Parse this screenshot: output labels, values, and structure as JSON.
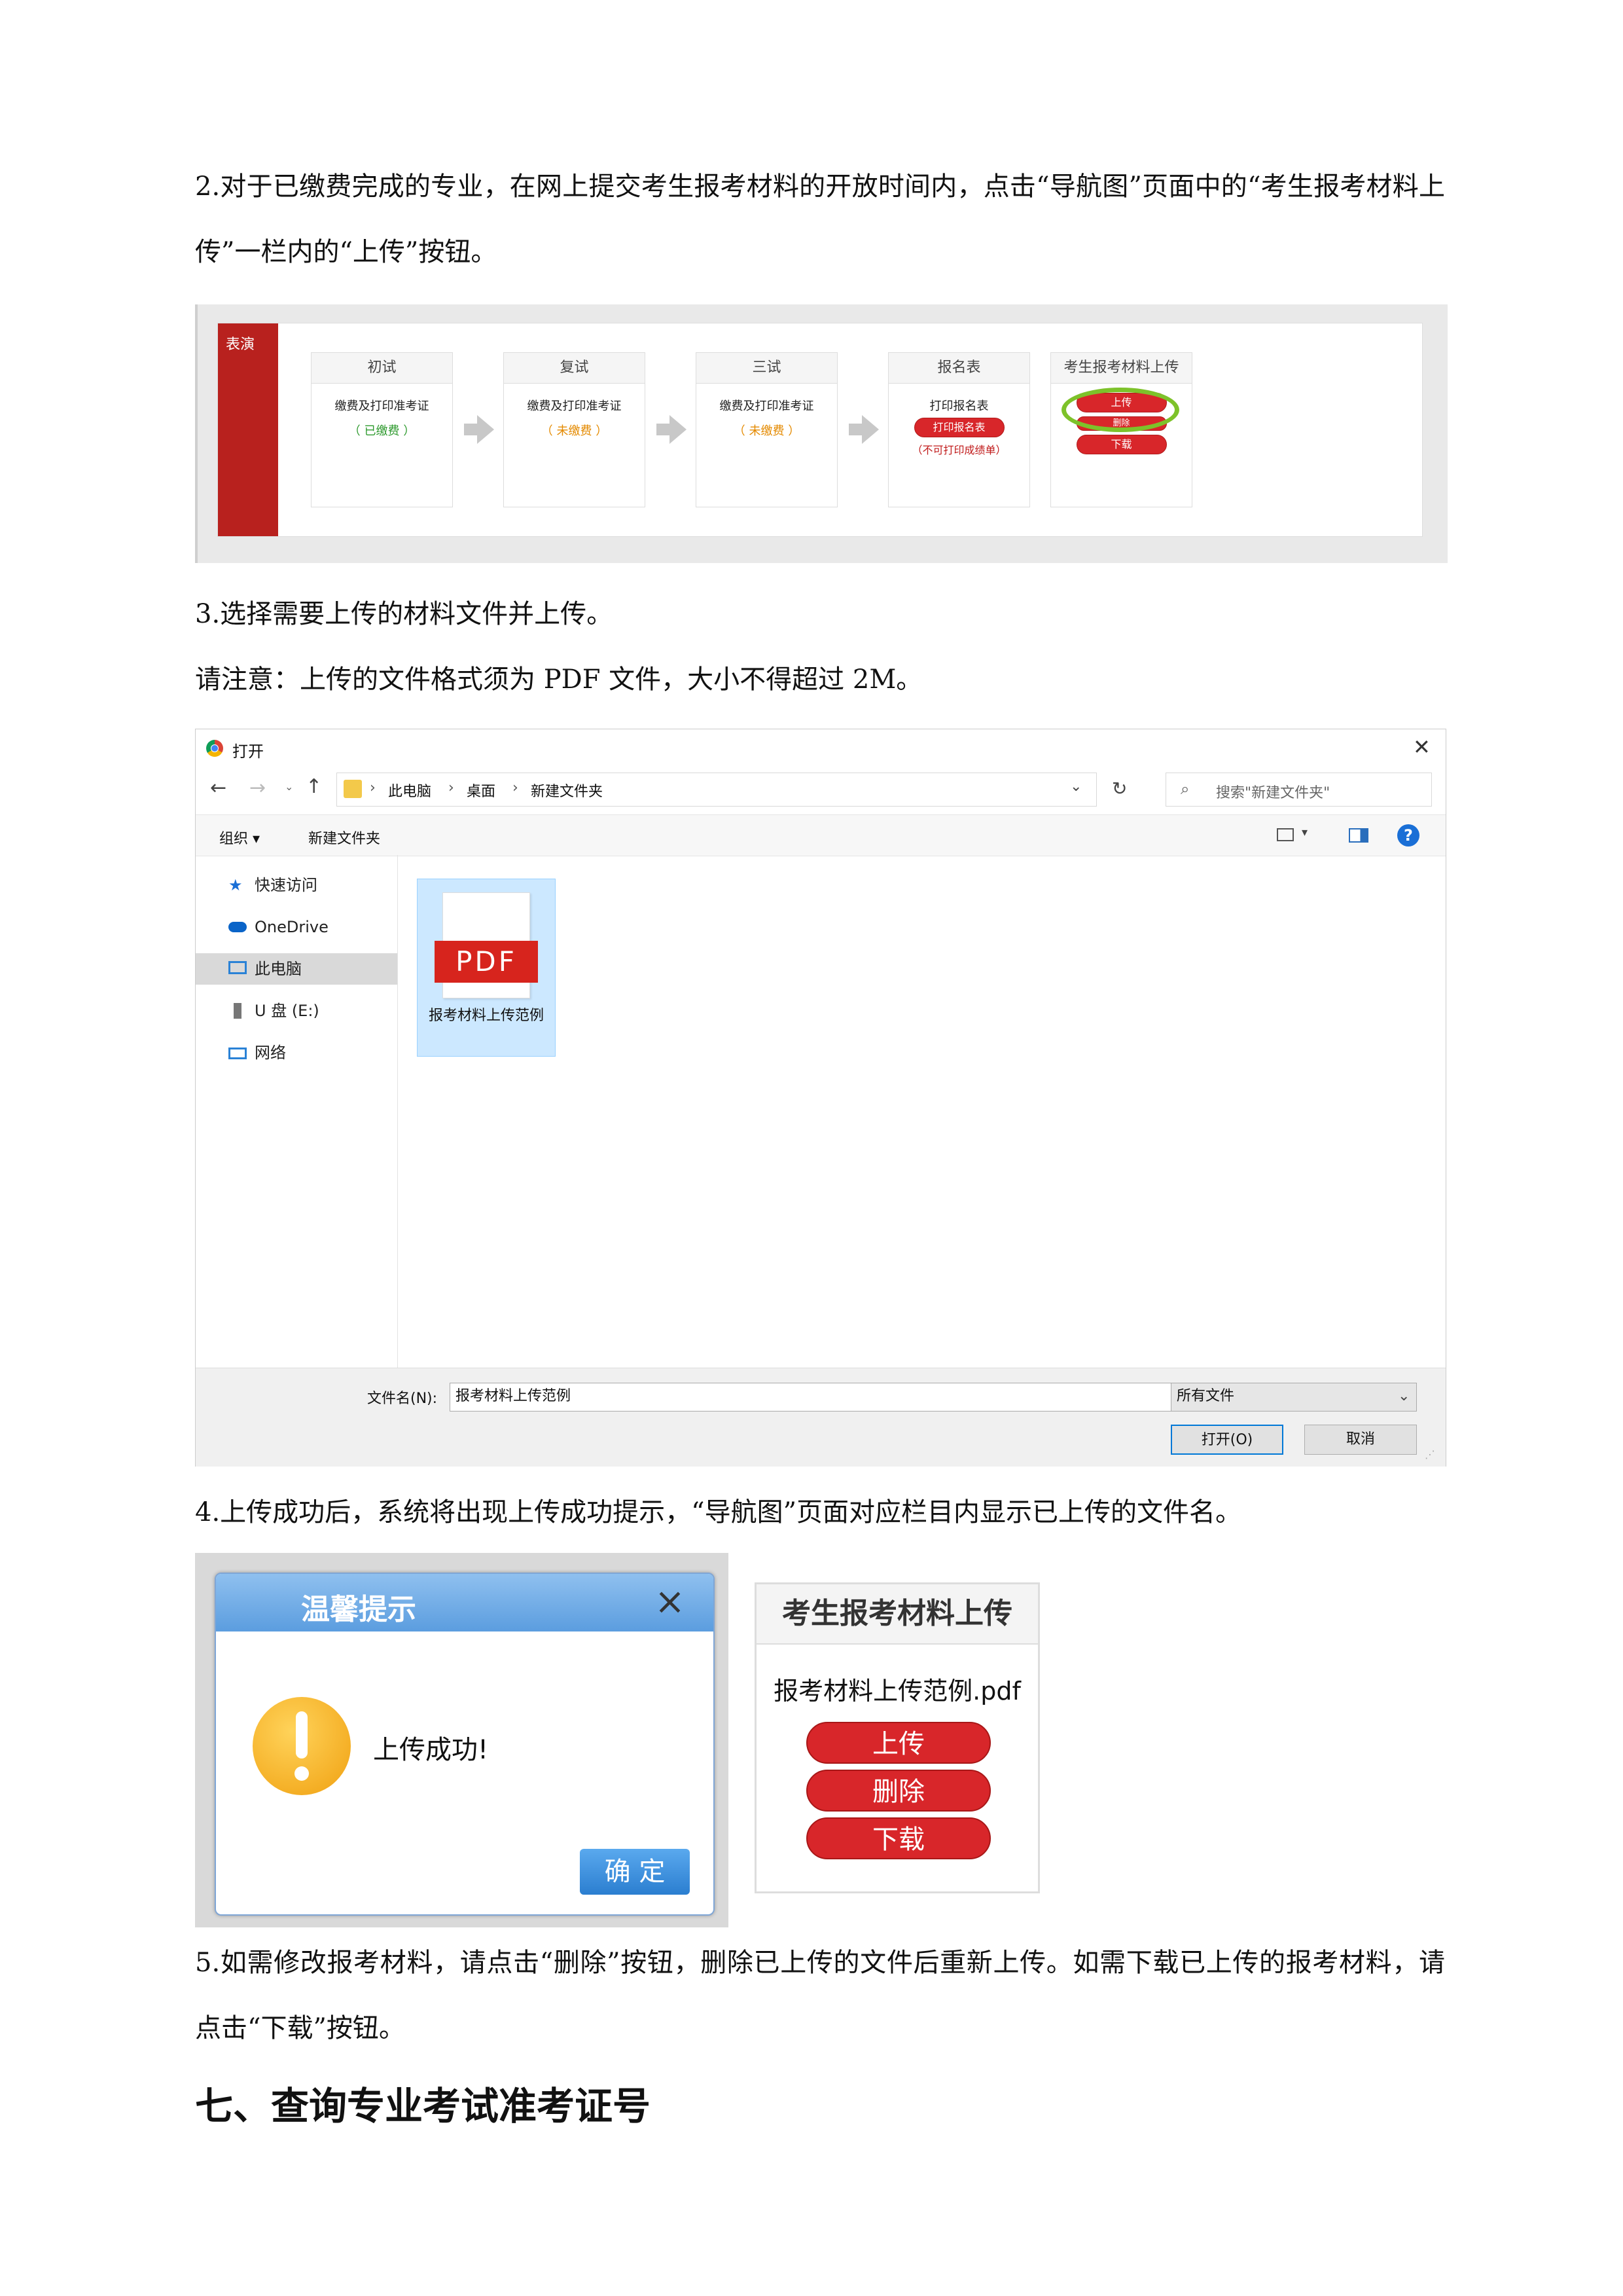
{
  "paragraphs": {
    "p1": "2.对于已缴费完成的专业，在网上提交考生报考材料的开放时间内，点击“导航图”页面中的“考生报考材料上传”一栏内的“上传”按钮。",
    "p2": "3.选择需要上传的材料文件并上传。",
    "p3": "请注意：上传的文件格式须为 PDF 文件，大小不得超过 2M。",
    "p4": "4.上传成功后，系统将出现上传成功提示，“导航图”页面对应栏目内显示已上传的文件名。",
    "p5": "5.如需修改报考材料，请点击“删除”按钮，删除已上传的文件后重新上传。如需下载已上传的报考材料，请点击“下载”按钮。"
  },
  "heading": "七、查询专业考试准考证号",
  "nav_panel": {
    "side_label": "表演",
    "steps": [
      {
        "title": "初试",
        "line": "缴费及打印准考证",
        "status": "（ 已缴费 ）"
      },
      {
        "title": "复试",
        "line": "缴费及打印准考证",
        "status": "（ 未缴费 ）"
      },
      {
        "title": "三试",
        "line": "缴费及打印准考证",
        "status": "（ 未缴费 ）"
      },
      {
        "title": "报名表",
        "line": "打印报名表",
        "button": "打印报名表",
        "status": "（不可打印成绩单）"
      }
    ],
    "upload": {
      "title": "考生报考材料上传",
      "upload_btn": "上传",
      "delete_btn": "删除",
      "download_btn": "下载"
    }
  },
  "file_dialog": {
    "title": "打开",
    "close": "✕",
    "path": [
      "此电脑",
      "桌面",
      "新建文件夹"
    ],
    "search_placeholder": "搜索\"新建文件夹\"",
    "organize": "组织 ▾",
    "new_folder": "新建文件夹",
    "sidebar": [
      "快速访问",
      "OneDrive",
      "此电脑",
      "U 盘 (E:)",
      "网络"
    ],
    "file": {
      "badge": "PDF",
      "name": "报考材料上传范例"
    },
    "filename_label": "文件名(N):",
    "filename_value": "报考材料上传范例",
    "filter": "所有文件",
    "open_btn": "打开(O)",
    "cancel_btn": "取消"
  },
  "success_dialog": {
    "title": "温馨提示",
    "message": "上传成功!",
    "ok": "确 定"
  },
  "upload_card": {
    "title": "考生报考材料上传",
    "filename": "报考材料上传范例.pdf",
    "upload": "上传",
    "delete": "删除",
    "download": "下载"
  }
}
